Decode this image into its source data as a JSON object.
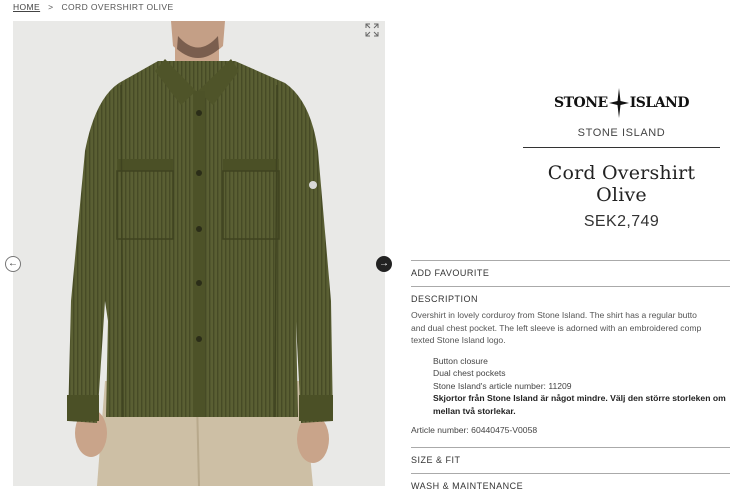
{
  "breadcrumb": {
    "home": "HOME",
    "separator": ">",
    "current": "CORD OVERSHIRT OLIVE"
  },
  "gallery": {
    "prev_icon": "arrow-left-icon",
    "next_icon": "arrow-right-icon",
    "expand_icon": "expand-icon"
  },
  "brand": {
    "logo_left": "STONE",
    "logo_right": "ISLAND",
    "name": "STONE ISLAND"
  },
  "product": {
    "title": "Cord Overshirt Olive",
    "price": "SEK2,749"
  },
  "sections": {
    "favourite": "ADD FAVOURITE",
    "description": "DESCRIPTION",
    "size_fit": "SIZE & FIT",
    "wash": "WASH & MAINTENANCE"
  },
  "description": {
    "lines": [
      "Overshirt in lovely corduroy from Stone Island. The shirt has a regular butto",
      "and dual chest pocket. The left sleeve is adorned with an embroidered comp",
      "texted Stone Island logo."
    ],
    "bullets": [
      "Button closure",
      "Dual chest pockets",
      "Stone Island's article number: 11209",
      "Skjortor från Stone Island är något mindre. Välj den större storleken om",
      "mellan två storlekar."
    ],
    "article": "Article number: 60440475-V0058"
  },
  "colors": {
    "shirt": "#5a5f33",
    "background": "#e9e9e7",
    "text": "#333333"
  }
}
